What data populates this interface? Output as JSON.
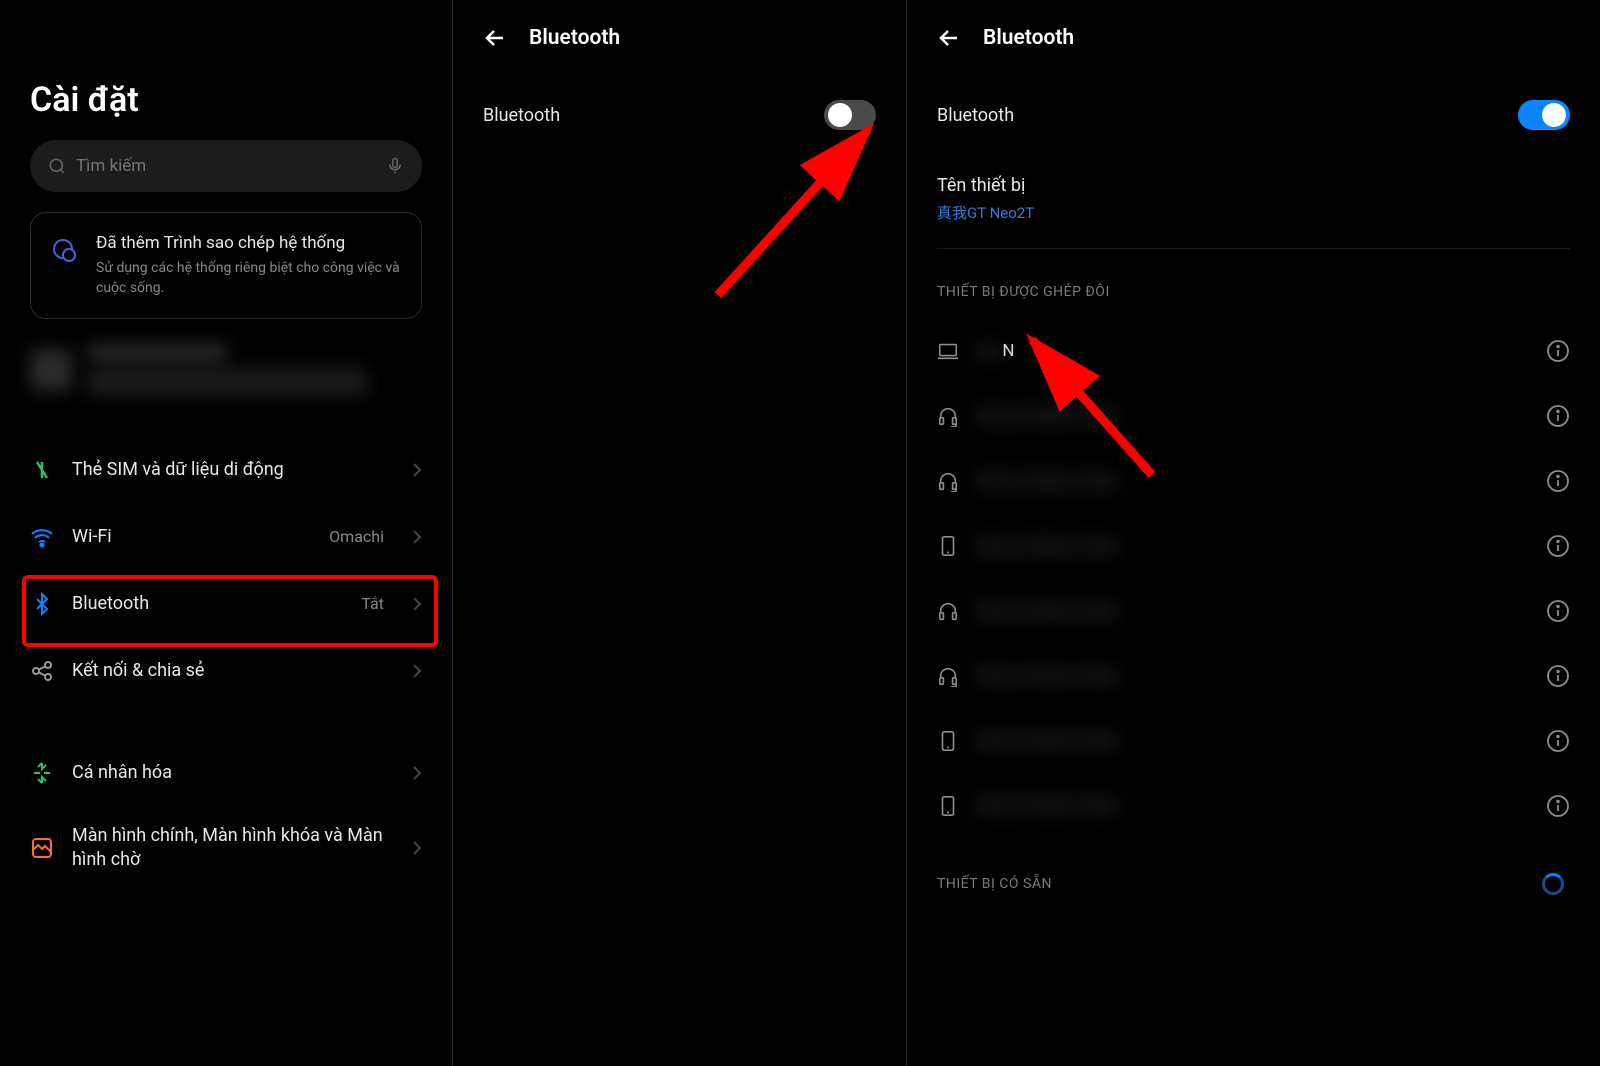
{
  "panel1": {
    "title": "Cài đặt",
    "search_placeholder": "Tìm kiếm",
    "info_card": {
      "title": "Đã thêm Trình sao chép hệ thống",
      "desc": "Sử dụng các hệ thống riêng biệt cho công việc và cuộc sống."
    },
    "items": [
      {
        "label": "Thẻ SIM và dữ liệu di động",
        "value": ""
      },
      {
        "label": "Wi-Fi",
        "value": "Omachi"
      },
      {
        "label": "Bluetooth",
        "value": "Tắt"
      },
      {
        "label": "Kết nối & chia sẻ",
        "value": ""
      },
      {
        "label": "Cá nhân hóa",
        "value": ""
      },
      {
        "label": "Màn hình chính, Màn hình khóa và Màn hình chờ",
        "value": ""
      }
    ]
  },
  "panel2": {
    "title": "Bluetooth",
    "toggle_label": "Bluetooth",
    "toggle_state": "off"
  },
  "panel3": {
    "title": "Bluetooth",
    "toggle_label": "Bluetooth",
    "toggle_state": "on",
    "device_name_label": "Tên thiết bị",
    "device_name_value": "真我GT Neo2T",
    "paired_header": "THIẾT BỊ ĐƯỢC GHÉP ĐÔI",
    "available_header": "THIẾT BỊ CÓ SẴN",
    "paired_devices": [
      {
        "icon": "laptop",
        "label": "N",
        "blurred_prefix": true
      },
      {
        "icon": "headset",
        "label": "",
        "blurred": true
      },
      {
        "icon": "headset",
        "label": "",
        "blurred": true
      },
      {
        "icon": "phone",
        "label": "",
        "blurred": true
      },
      {
        "icon": "headphone",
        "label": "",
        "blurred": true
      },
      {
        "icon": "headset",
        "label": "",
        "blurred": true
      },
      {
        "icon": "phone",
        "label": "",
        "blurred": true
      },
      {
        "icon": "phone",
        "label": "",
        "blurred": true
      }
    ]
  }
}
